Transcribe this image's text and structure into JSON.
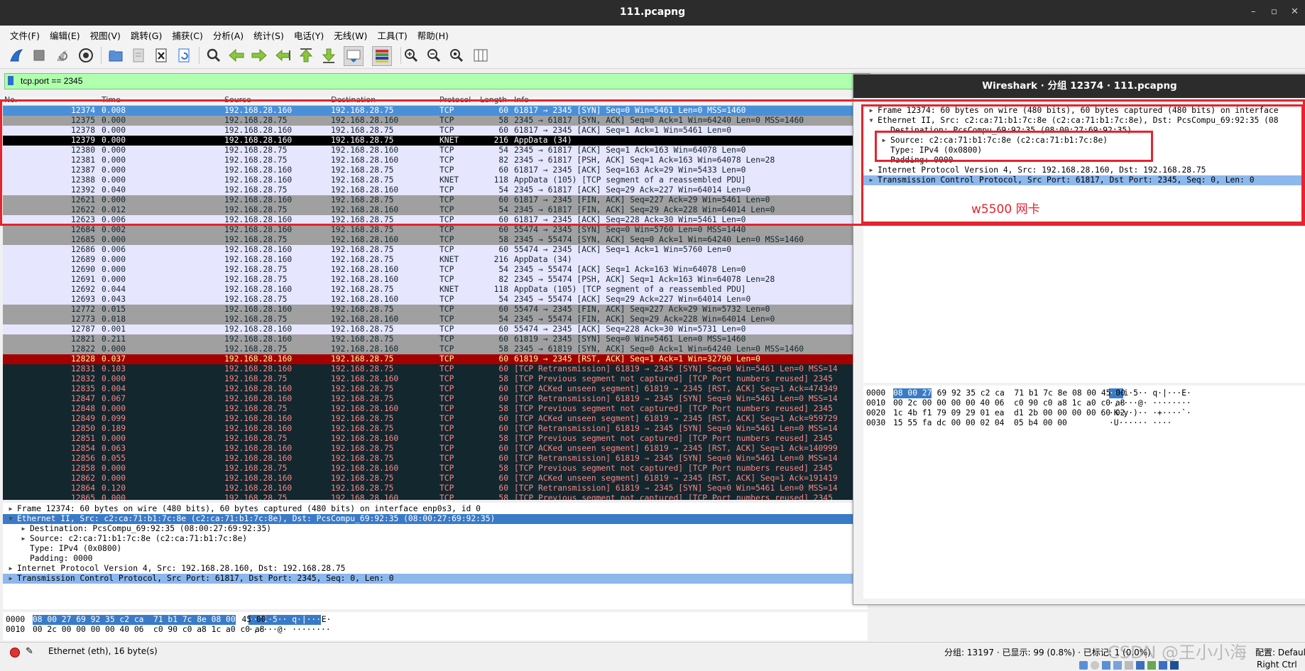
{
  "window": {
    "title": "111.pcapng",
    "minimize": "–",
    "maximize": "▫",
    "close": "✕"
  },
  "menu": [
    "文件(F)",
    "编辑(E)",
    "视图(V)",
    "跳转(G)",
    "捕获(C)",
    "分析(A)",
    "统计(S)",
    "电话(Y)",
    "无线(W)",
    "工具(T)",
    "帮助(H)"
  ],
  "toolbar_icons": [
    "shark-fin-start-icon",
    "stop-capture-icon",
    "restart-capture-icon",
    "capture-options-icon",
    "open-file-icon",
    "save-file-icon",
    "close-file-icon",
    "reload-icon",
    "find-packet-icon",
    "go-back-icon",
    "go-forward-icon",
    "go-to-packet-icon",
    "first-packet-icon",
    "last-packet-icon",
    "autoscroll-icon",
    "colorize-icon",
    "zoom-in-icon",
    "zoom-out-icon",
    "zoom-normal-icon",
    "resize-columns-icon"
  ],
  "filter": {
    "value": "tcp.port == 2345"
  },
  "columns": {
    "no": "No.",
    "time": "Time",
    "source": "Source",
    "destination": "Destination",
    "protocol": "Protocol",
    "length": "Length",
    "info": "Info"
  },
  "colors": {
    "sel_bg": "#4a90d9",
    "light": "#e7e6ff",
    "gray": "#a0a0a0",
    "dark": "#12272e",
    "dark_fg": "#f78787",
    "rst_bg": "#a40000",
    "rst_fg": "#fffc9c",
    "annotation": "#e6232e"
  },
  "packets": [
    {
      "no": "12374",
      "time": "0.008",
      "src": "192.168.28.160",
      "dst": "192.168.28.75",
      "proto": "TCP",
      "len": "60",
      "info": "61817 → 2345 [SYN] Seq=0 Win=5461 Len=0 MSS=1460",
      "style": "sel"
    },
    {
      "no": "12375",
      "time": "0.000",
      "src": "192.168.28.75",
      "dst": "192.168.28.160",
      "proto": "TCP",
      "len": "58",
      "info": "2345 → 61817 [SYN, ACK] Seq=0 Ack=1 Win=64240 Len=0 MSS=1460",
      "style": "gray"
    },
    {
      "no": "12378",
      "time": "0.000",
      "src": "192.168.28.160",
      "dst": "192.168.28.75",
      "proto": "TCP",
      "len": "60",
      "info": "61817 → 2345 [ACK] Seq=1 Ack=1 Win=5461 Len=0",
      "style": "light"
    },
    {
      "no": "12379",
      "time": "0.000",
      "src": "192.168.28.160",
      "dst": "192.168.28.75",
      "proto": "KNET",
      "len": "216",
      "info": "AppData (34)",
      "style": "blackrow"
    },
    {
      "no": "12380",
      "time": "0.000",
      "src": "192.168.28.75",
      "dst": "192.168.28.160",
      "proto": "TCP",
      "len": "54",
      "info": "2345 → 61817 [ACK] Seq=1 Ack=163 Win=64078 Len=0",
      "style": "light"
    },
    {
      "no": "12381",
      "time": "0.000",
      "src": "192.168.28.75",
      "dst": "192.168.28.160",
      "proto": "TCP",
      "len": "82",
      "info": "2345 → 61817 [PSH, ACK] Seq=1 Ack=163 Win=64078 Len=28",
      "style": "light"
    },
    {
      "no": "12387",
      "time": "0.000",
      "src": "192.168.28.160",
      "dst": "192.168.28.75",
      "proto": "TCP",
      "len": "60",
      "info": "61817 → 2345 [ACK] Seq=163 Ack=29 Win=5433 Len=0",
      "style": "light"
    },
    {
      "no": "12388",
      "time": "0.000",
      "src": "192.168.28.160",
      "dst": "192.168.28.75",
      "proto": "KNET",
      "len": "118",
      "info": "AppData (105) [TCP segment of a reassembled PDU]",
      "style": "light"
    },
    {
      "no": "12392",
      "time": "0.040",
      "src": "192.168.28.75",
      "dst": "192.168.28.160",
      "proto": "TCP",
      "len": "54",
      "info": "2345 → 61817 [ACK] Seq=29 Ack=227 Win=64014 Len=0",
      "style": "light"
    },
    {
      "no": "12621",
      "time": "0.000",
      "src": "192.168.28.160",
      "dst": "192.168.28.75",
      "proto": "TCP",
      "len": "60",
      "info": "61817 → 2345 [FIN, ACK] Seq=227 Ack=29 Win=5461 Len=0",
      "style": "gray"
    },
    {
      "no": "12622",
      "time": "0.012",
      "src": "192.168.28.75",
      "dst": "192.168.28.160",
      "proto": "TCP",
      "len": "54",
      "info": "2345 → 61817 [FIN, ACK] Seq=29 Ack=228 Win=64014 Len=0",
      "style": "gray"
    },
    {
      "no": "12623",
      "time": "0.006",
      "src": "192.168.28.160",
      "dst": "192.168.28.75",
      "proto": "TCP",
      "len": "60",
      "info": "61817 → 2345 [ACK] Seq=228 Ack=30 Win=5461 Len=0",
      "style": "light"
    },
    {
      "no": "12684",
      "time": "0.002",
      "src": "192.168.28.160",
      "dst": "192.168.28.75",
      "proto": "TCP",
      "len": "60",
      "info": "55474 → 2345 [SYN] Seq=0 Win=5760 Len=0 MSS=1440",
      "style": "gray"
    },
    {
      "no": "12685",
      "time": "0.000",
      "src": "192.168.28.75",
      "dst": "192.168.28.160",
      "proto": "TCP",
      "len": "58",
      "info": "2345 → 55474 [SYN, ACK] Seq=0 Ack=1 Win=64240 Len=0 MSS=1460",
      "style": "gray"
    },
    {
      "no": "12686",
      "time": "0.006",
      "src": "192.168.28.160",
      "dst": "192.168.28.75",
      "proto": "TCP",
      "len": "60",
      "info": "55474 → 2345 [ACK] Seq=1 Ack=1 Win=5760 Len=0",
      "style": "light"
    },
    {
      "no": "12689",
      "time": "0.000",
      "src": "192.168.28.160",
      "dst": "192.168.28.75",
      "proto": "KNET",
      "len": "216",
      "info": "AppData (34)",
      "style": "light"
    },
    {
      "no": "12690",
      "time": "0.000",
      "src": "192.168.28.75",
      "dst": "192.168.28.160",
      "proto": "TCP",
      "len": "54",
      "info": "2345 → 55474 [ACK] Seq=1 Ack=163 Win=64078 Len=0",
      "style": "light"
    },
    {
      "no": "12691",
      "time": "0.000",
      "src": "192.168.28.75",
      "dst": "192.168.28.160",
      "proto": "TCP",
      "len": "82",
      "info": "2345 → 55474 [PSH, ACK] Seq=1 Ack=163 Win=64078 Len=28",
      "style": "light"
    },
    {
      "no": "12692",
      "time": "0.044",
      "src": "192.168.28.160",
      "dst": "192.168.28.75",
      "proto": "KNET",
      "len": "118",
      "info": "AppData (105) [TCP segment of a reassembled PDU]",
      "style": "light"
    },
    {
      "no": "12693",
      "time": "0.043",
      "src": "192.168.28.75",
      "dst": "192.168.28.160",
      "proto": "TCP",
      "len": "54",
      "info": "2345 → 55474 [ACK] Seq=29 Ack=227 Win=64014 Len=0",
      "style": "light"
    },
    {
      "no": "12772",
      "time": "0.015",
      "src": "192.168.28.160",
      "dst": "192.168.28.75",
      "proto": "TCP",
      "len": "60",
      "info": "55474 → 2345 [FIN, ACK] Seq=227 Ack=29 Win=5732 Len=0",
      "style": "gray"
    },
    {
      "no": "12773",
      "time": "0.018",
      "src": "192.168.28.75",
      "dst": "192.168.28.160",
      "proto": "TCP",
      "len": "54",
      "info": "2345 → 55474 [FIN, ACK] Seq=29 Ack=228 Win=64014 Len=0",
      "style": "gray"
    },
    {
      "no": "12787",
      "time": "0.001",
      "src": "192.168.28.160",
      "dst": "192.168.28.75",
      "proto": "TCP",
      "len": "60",
      "info": "55474 → 2345 [ACK] Seq=228 Ack=30 Win=5731 Len=0",
      "style": "light"
    },
    {
      "no": "12821",
      "time": "0.211",
      "src": "192.168.28.160",
      "dst": "192.168.28.75",
      "proto": "TCP",
      "len": "60",
      "info": "61819 → 2345 [SYN] Seq=0 Win=5461 Len=0 MSS=1460",
      "style": "gray"
    },
    {
      "no": "12822",
      "time": "0.000",
      "src": "192.168.28.75",
      "dst": "192.168.28.160",
      "proto": "TCP",
      "len": "58",
      "info": "2345 → 61819 [SYN, ACK] Seq=0 Ack=1 Win=64240 Len=0 MSS=1460",
      "style": "gray"
    },
    {
      "no": "12828",
      "time": "0.037",
      "src": "192.168.28.160",
      "dst": "192.168.28.75",
      "proto": "TCP",
      "len": "60",
      "info": "61819 → 2345 [RST, ACK] Seq=1 Ack=1 Win=32790 Len=0",
      "style": "rst"
    },
    {
      "no": "12831",
      "time": "0.103",
      "src": "192.168.28.160",
      "dst": "192.168.28.75",
      "proto": "TCP",
      "len": "60",
      "info": "[TCP Retransmission] 61819 → 2345 [SYN] Seq=0 Win=5461 Len=0 MSS=14",
      "style": "dark"
    },
    {
      "no": "12832",
      "time": "0.000",
      "src": "192.168.28.75",
      "dst": "192.168.28.160",
      "proto": "TCP",
      "len": "58",
      "info": "[TCP Previous segment not captured] [TCP Port numbers reused] 2345",
      "style": "dark"
    },
    {
      "no": "12835",
      "time": "0.004",
      "src": "192.168.28.160",
      "dst": "192.168.28.75",
      "proto": "TCP",
      "len": "60",
      "info": "[TCP ACKed unseen segment] 61819 → 2345 [RST, ACK] Seq=1 Ack=474349",
      "style": "dark"
    },
    {
      "no": "12847",
      "time": "0.067",
      "src": "192.168.28.160",
      "dst": "192.168.28.75",
      "proto": "TCP",
      "len": "60",
      "info": "[TCP Retransmission] 61819 → 2345 [SYN] Seq=0 Win=5461 Len=0 MSS=14",
      "style": "dark"
    },
    {
      "no": "12848",
      "time": "0.000",
      "src": "192.168.28.75",
      "dst": "192.168.28.160",
      "proto": "TCP",
      "len": "58",
      "info": "[TCP Previous segment not captured] [TCP Port numbers reused] 2345",
      "style": "dark"
    },
    {
      "no": "12849",
      "time": "0.099",
      "src": "192.168.28.160",
      "dst": "192.168.28.75",
      "proto": "TCP",
      "len": "60",
      "info": "[TCP ACKed unseen segment] 61819 → 2345 [RST, ACK] Seq=1 Ack=959729",
      "style": "dark"
    },
    {
      "no": "12850",
      "time": "0.189",
      "src": "192.168.28.160",
      "dst": "192.168.28.75",
      "proto": "TCP",
      "len": "60",
      "info": "[TCP Retransmission] 61819 → 2345 [SYN] Seq=0 Win=5461 Len=0 MSS=14",
      "style": "dark"
    },
    {
      "no": "12851",
      "time": "0.000",
      "src": "192.168.28.75",
      "dst": "192.168.28.160",
      "proto": "TCP",
      "len": "58",
      "info": "[TCP Previous segment not captured] [TCP Port numbers reused] 2345",
      "style": "dark"
    },
    {
      "no": "12854",
      "time": "0.063",
      "src": "192.168.28.160",
      "dst": "192.168.28.75",
      "proto": "TCP",
      "len": "60",
      "info": "[TCP ACKed unseen segment] 61819 → 2345 [RST, ACK] Seq=1 Ack=140999",
      "style": "dark"
    },
    {
      "no": "12856",
      "time": "0.055",
      "src": "192.168.28.160",
      "dst": "192.168.28.75",
      "proto": "TCP",
      "len": "60",
      "info": "[TCP Retransmission] 61819 → 2345 [SYN] Seq=0 Win=5461 Len=0 MSS=14",
      "style": "dark"
    },
    {
      "no": "12858",
      "time": "0.000",
      "src": "192.168.28.75",
      "dst": "192.168.28.160",
      "proto": "TCP",
      "len": "58",
      "info": "[TCP Previous segment not captured] [TCP Port numbers reused] 2345",
      "style": "dark"
    },
    {
      "no": "12862",
      "time": "0.000",
      "src": "192.168.28.160",
      "dst": "192.168.28.75",
      "proto": "TCP",
      "len": "60",
      "info": "[TCP ACKed unseen segment] 61819 → 2345 [RST, ACK] Seq=1 Ack=191419",
      "style": "dark"
    },
    {
      "no": "12864",
      "time": "0.120",
      "src": "192.168.28.160",
      "dst": "192.168.28.75",
      "proto": "TCP",
      "len": "60",
      "info": "[TCP Retransmission] 61819 → 2345 [SYN] Seq=0 Win=5461 Len=0 MSS=14",
      "style": "dark"
    },
    {
      "no": "12865",
      "time": "0.000",
      "src": "192.168.28.75",
      "dst": "192.168.28.160",
      "proto": "TCP",
      "len": "58",
      "info": "[TCP Previous segment not captured] [TCP Port numbers reused] 2345",
      "style": "dark"
    }
  ],
  "details": [
    {
      "arrow": "▶",
      "indent": 0,
      "text": "Frame 12374: 60 bytes on wire (480 bits), 60 bytes captured (480 bits) on interface enp0s3, id 0",
      "sel": false
    },
    {
      "arrow": "▼",
      "indent": 0,
      "text": "Ethernet II, Src: c2:ca:71:b1:7c:8e (c2:ca:71:b1:7c:8e), Dst: PcsCompu_69:92:35 (08:00:27:69:92:35)",
      "sel": true
    },
    {
      "arrow": "▶",
      "indent": 1,
      "text": "Destination: PcsCompu_69:92:35 (08:00:27:69:92:35)",
      "sel": false
    },
    {
      "arrow": "▶",
      "indent": 1,
      "text": "Source: c2:ca:71:b1:7c:8e (c2:ca:71:b1:7c:8e)",
      "sel": false
    },
    {
      "arrow": "",
      "indent": 1,
      "text": "Type: IPv4 (0x0800)",
      "sel": false
    },
    {
      "arrow": "",
      "indent": 1,
      "text": "Padding: 0000",
      "sel": false
    },
    {
      "arrow": "▶",
      "indent": 0,
      "text": "Internet Protocol Version 4, Src: 192.168.28.160, Dst: 192.168.28.75",
      "sel": false
    },
    {
      "arrow": "▶",
      "indent": 0,
      "text": "Transmission Control Protocol, Src Port: 61817, Dst Port: 2345, Seq: 0, Len: 0",
      "sel": "alt"
    }
  ],
  "bytes": [
    {
      "off": "0000",
      "hexsel": "08 00 27 69 92 35 c2 ca  71 b1 7c 8e 08 00",
      "hexrest": " 45 00",
      "ascsel": "··'i·5·· q·|···",
      "ascrest": "E·"
    },
    {
      "off": "0010",
      "hexsel": "",
      "hexrest": "00 2c 00 00 00 00 40 06  c0 90 c0 a8 1c a0 c0 a8",
      "ascsel": "",
      "ascrest": "·,····@· ········"
    }
  ],
  "status": {
    "left": "Ethernet (eth), 16 byte(s)",
    "right": "分组: 13197 · 已显示: 99 (0.8%) · 已标记: 1 (0.0%)",
    "profile": "配置: Default",
    "watermark": "CSDN @王小小海",
    "extra": "Right Ctrl"
  },
  "popup": {
    "title": "Wireshark · 分组 12374 · 111.pcapng",
    "tree": [
      {
        "arrow": "▶",
        "indent": 0,
        "text": "Frame 12374: 60 bytes on wire (480 bits), 60 bytes captured (480 bits) on interface",
        "sel": false
      },
      {
        "arrow": "▼",
        "indent": 0,
        "text": "Ethernet II, Src: c2:ca:71:b1:7c:8e (c2:ca:71:b1:7c:8e), Dst: PcsCompu_69:92:35 (08",
        "sel": false
      },
      {
        "arrow": "",
        "indent": 1,
        "text": "Destination: PcsCompu_69:92:35 (08:00:27:69:92:35)",
        "sel": false
      },
      {
        "arrow": "▶",
        "indent": 1,
        "text": "Source: c2:ca:71:b1:7c:8e (c2:ca:71:b1:7c:8e)",
        "sel": false
      },
      {
        "arrow": "",
        "indent": 1,
        "text": "Type: IPv4 (0x0800)",
        "sel": false
      },
      {
        "arrow": "",
        "indent": 1,
        "text": "Padding: 0000",
        "sel": false
      },
      {
        "arrow": "▶",
        "indent": 0,
        "text": "Internet Protocol Version 4, Src: 192.168.28.160, Dst: 192.168.28.75",
        "sel": false
      },
      {
        "arrow": "▶",
        "indent": 0,
        "text": "Transmission Control Protocol, Src Port: 61817, Dst Port: 2345, Seq: 0, Len: 0",
        "sel": true
      }
    ],
    "bytes": [
      {
        "off": "0000",
        "hexsel": "08 00 27",
        "hexrest": " 69 92 35 c2 ca  71 b1 7c 8e 08 00 45 00",
        "ascsel": "··'",
        "ascrest": "i·5·· q·|···E·"
      },
      {
        "off": "0010",
        "hexsel": "",
        "hexrest": "00 2c 00 00 00 00 40 06  c0 90 c0 a8 1c a0 c0 a8",
        "ascsel": "",
        "ascrest": "·,····@· ········"
      },
      {
        "off": "0020",
        "hexsel": "",
        "hexrest": "1c 4b f1 79 09 29 01 ea  d1 2b 00 00 00 00 60 02",
        "ascsel": "",
        "ascrest": "·K·y·)·· ·+····`·"
      },
      {
        "off": "0030",
        "hexsel": "",
        "hexrest": "15 55 fa dc 00 00 02 04  05 b4 00 00",
        "ascsel": "",
        "ascrest": "·U······ ····"
      }
    ],
    "annotation": "w5500 网卡"
  }
}
